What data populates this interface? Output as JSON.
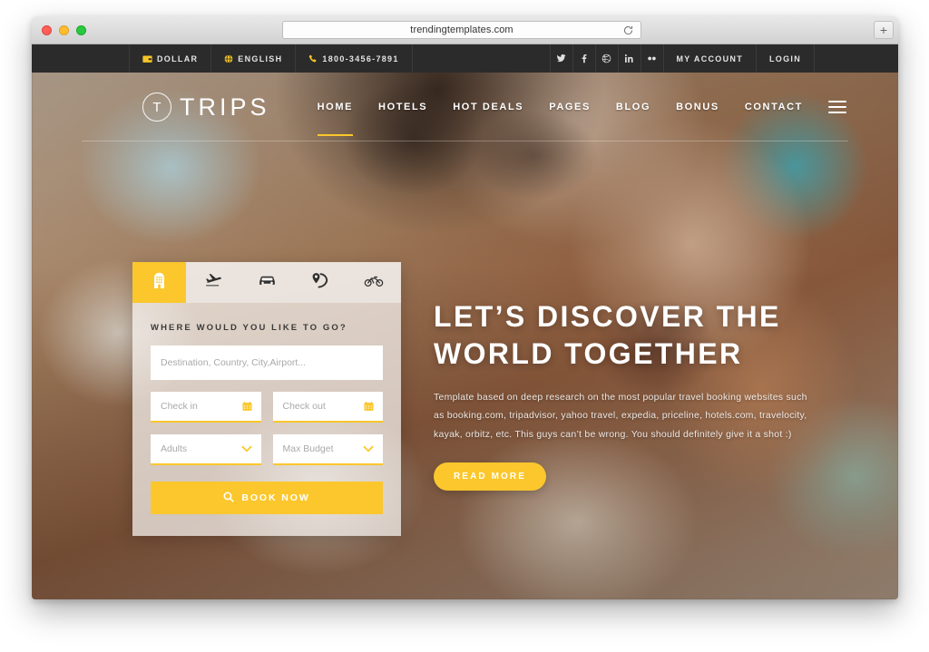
{
  "browser": {
    "url": "trendingtemplates.com",
    "reload_icon": "reload-icon",
    "newtab_label": "+"
  },
  "topbar": {
    "left_items": [
      {
        "icon": "wallet-icon",
        "label": "DOLLAR"
      },
      {
        "icon": "globe-icon",
        "label": "ENGLISH"
      },
      {
        "icon": "phone-icon",
        "label": "1800-3456-7891"
      }
    ],
    "social": [
      {
        "icon": "twitter-icon",
        "glyph": "𝕏"
      },
      {
        "icon": "facebook-icon",
        "glyph": "f"
      },
      {
        "icon": "dribbble-icon",
        "glyph": "◎"
      },
      {
        "icon": "linkedin-icon",
        "glyph": "in"
      },
      {
        "icon": "flickr-icon",
        "glyph": "••"
      }
    ],
    "account_label": "MY ACCOUNT",
    "login_label": "LOGIN"
  },
  "header": {
    "logo_mark": "T",
    "logo_text": "TRIPS",
    "nav": [
      {
        "label": "HOME",
        "active": true
      },
      {
        "label": "HOTELS",
        "active": false
      },
      {
        "label": "HOT DEALS",
        "active": false
      },
      {
        "label": "PAGES",
        "active": false
      },
      {
        "label": "BLOG",
        "active": false
      },
      {
        "label": "BONUS",
        "active": false
      },
      {
        "label": "CONTACT",
        "active": false
      }
    ],
    "menu_icon": "hamburger-icon"
  },
  "booking": {
    "tabs": [
      {
        "icon": "hotel-icon",
        "active": true
      },
      {
        "icon": "plane-icon",
        "active": false
      },
      {
        "icon": "car-icon",
        "active": false
      },
      {
        "icon": "tour-location-icon",
        "active": false
      },
      {
        "icon": "bicycle-icon",
        "active": false
      }
    ],
    "form_label": "WHERE WOULD YOU LIKE TO GO?",
    "destination_placeholder": "Destination, Country, City,Airport...",
    "checkin_placeholder": "Check in",
    "checkout_placeholder": "Check out",
    "adults_placeholder": "Adults",
    "budget_placeholder": "Max Budget",
    "submit_label": "BOOK NOW",
    "submit_icon": "search-icon",
    "calendar_icon": "calendar-icon",
    "chevron_icon": "chevron-down-icon"
  },
  "hero": {
    "title_line1": "LET’S DISCOVER THE",
    "title_line2": "WORLD TOGETHER",
    "paragraph": "Template based on deep research on the most popular travel booking websites such as booking.com, tripadvisor, yahoo travel, expedia, priceline, hotels.com, travelocity, kayak, orbitz, etc. This guys can’t be wrong. You should definitely give it a shot :)",
    "cta_label": "READ MORE"
  },
  "colors": {
    "accent": "#fbc72c",
    "topbar_bg": "#2b2b2b",
    "text_light": "#ffffff"
  }
}
